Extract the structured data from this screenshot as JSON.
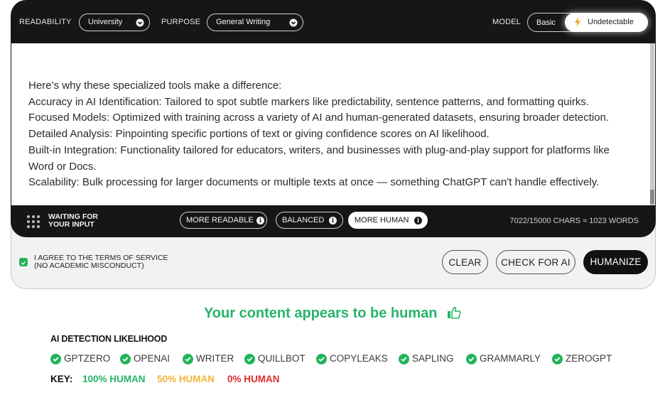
{
  "toolbar": {
    "readability_label": "READABILITY",
    "readability_value": "University",
    "purpose_label": "PURPOSE",
    "purpose_value": "General Writing",
    "model_label": "MODEL",
    "model_options": [
      "Basic",
      "Undetectable"
    ],
    "model_selected": "Undetectable"
  },
  "editor": {
    "paragraphs": [
      "Here’s why these specialized tools make a difference:",
      "Accuracy in AI Identification: Tailored to spot subtle markers like predictability, sentence patterns, and formatting quirks.",
      "Focused Models: Optimized with training across a variety of AI and human-generated datasets, ensuring broader detection.",
      "Detailed Analysis: Pinpointing specific portions of text or giving confidence scores on AI likelihood.",
      "Built-in Integration: Functionality tailored for educators, writers, and businesses with plug-and-play support for platforms like Word or Docs.",
      "Scalability: Bulk processing for larger documents or multiple texts at once — something ChatGPT can't handle effectively."
    ],
    "scroll_position": 0.95
  },
  "status": {
    "line1": "WAITING FOR",
    "line2": "YOUR INPUT"
  },
  "modes": {
    "items": [
      {
        "label": "MORE READABLE",
        "active": false
      },
      {
        "label": "BALANCED",
        "active": false
      },
      {
        "label": "MORE HUMAN",
        "active": true
      }
    ],
    "info_glyph": "i"
  },
  "counter": "7022/15000 CHARS ≈ 1023 WORDS",
  "terms": {
    "checked": true,
    "line1": "I AGREE TO THE TERMS OF SERVICE",
    "line2": "(NO ACADEMIC MISCONDUCT)"
  },
  "actions": {
    "clear": "CLEAR",
    "check": "CHECK FOR AI",
    "humanize": "HUMANIZE"
  },
  "result": {
    "title": "Your content appears to be human",
    "icon": "thumbs-up-icon",
    "color": "#27b46b"
  },
  "detection": {
    "heading": "AI DETECTION LIKELIHOOD",
    "detectors": [
      {
        "name": "GPTZERO",
        "status": "human"
      },
      {
        "name": "OPENAI",
        "status": "human"
      },
      {
        "name": "WRITER",
        "status": "human"
      },
      {
        "name": "QUILLBOT",
        "status": "human"
      },
      {
        "name": "COPYLEAKS",
        "status": "human"
      },
      {
        "name": "SAPLING",
        "status": "human"
      },
      {
        "name": "GRAMMARLY",
        "status": "human"
      },
      {
        "name": "ZEROGPT",
        "status": "human"
      }
    ],
    "check_color": "#22b35a"
  },
  "key": {
    "label": "KEY:",
    "items": [
      {
        "label": "100% HUMAN",
        "color": "#27b46b"
      },
      {
        "label": "50% HUMAN",
        "color": "#f5b43a"
      },
      {
        "label": "0% HUMAN",
        "color": "#e02b2b"
      }
    ]
  }
}
